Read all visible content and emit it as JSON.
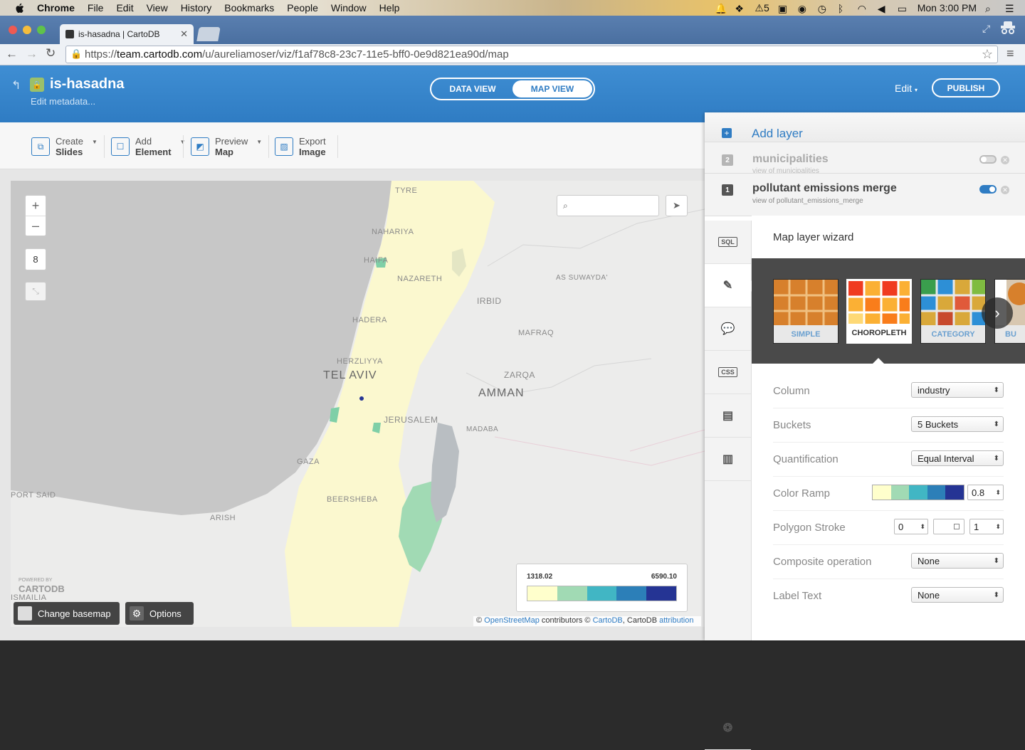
{
  "menubar": {
    "app": "Chrome",
    "items": [
      "File",
      "Edit",
      "View",
      "History",
      "Bookmarks",
      "People",
      "Window",
      "Help"
    ],
    "status_number": "5",
    "clock": "Mon 3:00 PM"
  },
  "browser": {
    "tab_title": "is-hasadna | CartoDB",
    "url_scheme": "https://",
    "url_host": "team.cartodb.com",
    "url_path": "/u/aureliamoser/viz/f1af78c8-23c7-11e5-bff0-0e9d821ea90d/map"
  },
  "header": {
    "viz_name": "is-hasadna",
    "edit_metadata": "Edit metadata...",
    "data_view": "DATA VIEW",
    "map_view": "MAP VIEW",
    "edit": "Edit",
    "publish": "PUBLISH"
  },
  "tools": [
    {
      "top": "Create",
      "bottom": "Slides"
    },
    {
      "top": "Add",
      "bottom": "Element"
    },
    {
      "top": "Preview",
      "bottom": "Map"
    },
    {
      "top": "Export",
      "bottom": "Image"
    }
  ],
  "map": {
    "zoom_in": "+",
    "zoom_out": "–",
    "zoom_level": "8",
    "labels": [
      "TYRE",
      "NAHARIYA",
      "HAIFA",
      "NAZARETH",
      "AS SUWAYDA'",
      "IRBID",
      "HADERA",
      "MAFRAQ",
      "HERZLIYYA",
      "TEL AVIV",
      "ZARQA",
      "AMMAN",
      "JERUSALEM",
      "MADABA",
      "GAZA",
      "BEERSHEBA",
      "PORT SAID",
      "ARISH",
      "ISMAILIA"
    ],
    "legend_low": "1318.02",
    "legend_high": "6590.10",
    "legend_colors": [
      "#ffffcc",
      "#a1dab4",
      "#41b6c4",
      "#2c7fb8",
      "#253494"
    ],
    "change_basemap": "Change basemap",
    "options": "Options",
    "powered_by": "POWERED BY",
    "powered_brand": "CARTODB",
    "attribution_prefix": "©",
    "attribution_osm": "OpenStreetMap",
    "attribution_mid": " contributors © ",
    "attribution_cartodb": "CartoDB",
    "attribution_mid2": ", CartoDB ",
    "attribution_link": "attribution"
  },
  "panel": {
    "add_layer": "Add layer",
    "layers": [
      {
        "num": "2",
        "name": "municipalities",
        "sub": "view of municipalities",
        "enabled": false
      },
      {
        "num": "1",
        "name": "pollutant emissions merge",
        "sub": "view of pollutant_emissions_merge",
        "enabled": true
      }
    ],
    "side_tools": [
      "SQL",
      "wizard",
      "infowindow",
      "CSS",
      "legend",
      "filters",
      "tooltips"
    ],
    "wizard_title": "Map layer wizard",
    "wizard_types": [
      "SIMPLE",
      "CHOROPLETH",
      "CATEGORY",
      "BU"
    ],
    "properties": {
      "column_label": "Column",
      "column_value": "industry",
      "buckets_label": "Buckets",
      "buckets_value": "5 Buckets",
      "quant_label": "Quantification",
      "quant_value": "Equal Interval",
      "ramp_label": "Color Ramp",
      "ramp_opacity": "0.8",
      "ramp_colors": [
        "#ffffcc",
        "#a1dab4",
        "#41b6c4",
        "#2c7fb8",
        "#253494"
      ],
      "stroke_label": "Polygon Stroke",
      "stroke_width": "0",
      "stroke_opacity": "1",
      "composite_label": "Composite operation",
      "composite_value": "None",
      "labeltext_label": "Label Text",
      "labeltext_value": "None"
    }
  }
}
